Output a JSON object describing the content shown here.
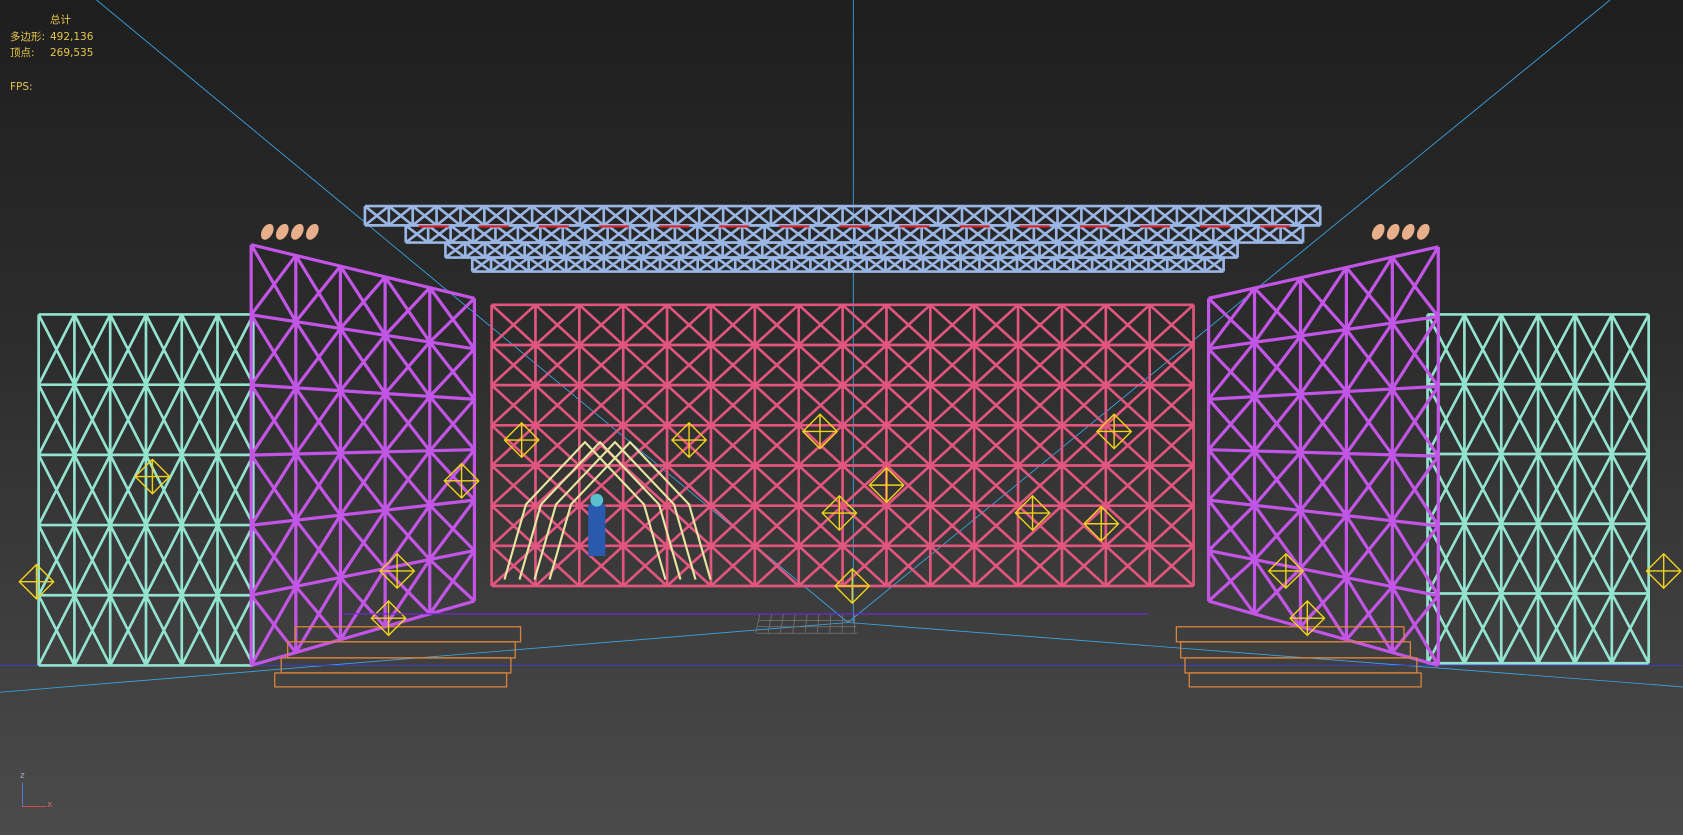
{
  "viewport": {
    "stats": {
      "header": "总计",
      "polygons_label": "多边形:",
      "polygons_value": "492,136",
      "vertices_label": "顶点:",
      "vertices_value": "269,535",
      "fps_label": "FPS:"
    },
    "axis_gizmo": {
      "z_label": "z",
      "x_label": "x"
    },
    "colors": {
      "center_truss": "#e2557f",
      "side_truss": "#c255e6",
      "outer_truss": "#93e3cf",
      "top_truss": "#9ab6e4",
      "lights": "#f2d21a",
      "platforms": "#d9843a",
      "camera_lines": "#3aa6e6"
    }
  }
}
